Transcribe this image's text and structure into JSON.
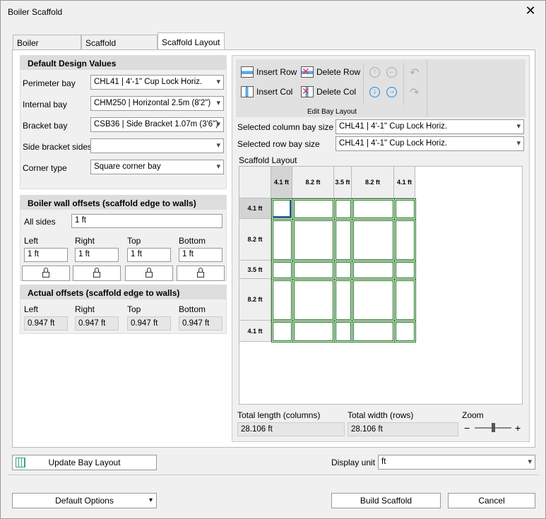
{
  "window": {
    "title": "Boiler Scaffold",
    "close": "✕"
  },
  "tabs": [
    {
      "label": "Boiler Properties"
    },
    {
      "label": "Scaffold Properties"
    },
    {
      "label": "Scaffold Layout",
      "active": true
    }
  ],
  "design": {
    "heading": "Default Design Values",
    "fields": [
      {
        "label": "Perimeter bay",
        "value": "CHL41 | 4'-1\" Cup Lock Horiz."
      },
      {
        "label": "Internal bay",
        "value": "CHM250 | Horizontal 2.5m (8'2\")"
      },
      {
        "label": "Bracket bay",
        "value": "CSB36 | Side Bracket 1.07m (3'6\")"
      },
      {
        "label": "Side bracket sides",
        "value": ""
      },
      {
        "label": "Corner type",
        "value": "Square corner bay"
      }
    ]
  },
  "wall_offsets": {
    "heading": "Boiler wall offsets (scaffold edge to walls)",
    "all_sides_label": "All sides",
    "all_sides": "1 ft",
    "sides": [
      {
        "label": "Left",
        "value": "1 ft"
      },
      {
        "label": "Right",
        "value": "1 ft"
      },
      {
        "label": "Top",
        "value": "1 ft"
      },
      {
        "label": "Bottom",
        "value": "1 ft"
      }
    ],
    "lock_icon": "unlocked-padlock-icon"
  },
  "actual_offsets": {
    "heading": "Actual offsets (scaffold edge to walls)",
    "sides": [
      {
        "label": "Left",
        "value": "0.947 ft"
      },
      {
        "label": "Right",
        "value": "0.947 ft"
      },
      {
        "label": "Top",
        "value": "0.947 ft"
      },
      {
        "label": "Bottom",
        "value": "0.947 ft"
      }
    ]
  },
  "ribbon": {
    "insert_row": "Insert Row",
    "delete_row": "Delete Row",
    "insert_col": "Insert Col",
    "delete_col": "Delete Col",
    "group_label": "Edit Bay Layout",
    "accent": "#1e88e5"
  },
  "selected": {
    "col_label": "Selected column bay size",
    "col_value": "CHL41 | 4'-1\" Cup Lock Horiz.",
    "row_label": "Selected row bay size",
    "row_value": "CHL41 | 4'-1\" Cup Lock Horiz."
  },
  "layout": {
    "label": "Scaffold Layout",
    "columns": [
      "4.1 ft",
      "8.2 ft",
      "3.5 ft",
      "8.2 ft",
      "4.1 ft"
    ],
    "rows": [
      "4.1 ft",
      "8.2 ft",
      "3.5 ft",
      "8.2 ft",
      "4.1 ft"
    ],
    "grid_color": "#1b6e1b",
    "selected_cell": [
      0,
      0
    ]
  },
  "totals": {
    "length_label": "Total length (columns)",
    "length": "28.106 ft",
    "width_label": "Total width (rows)",
    "width": "28.106 ft",
    "zoom_label": "Zoom",
    "zoom_minus": "−",
    "zoom_plus": "+",
    "zoom_level": 0.5
  },
  "footer": {
    "update": "Update Bay Layout",
    "display_unit_label": "Display unit",
    "display_unit": "ft",
    "default_options": "Default Options",
    "build": "Build Scaffold",
    "cancel": "Cancel"
  }
}
